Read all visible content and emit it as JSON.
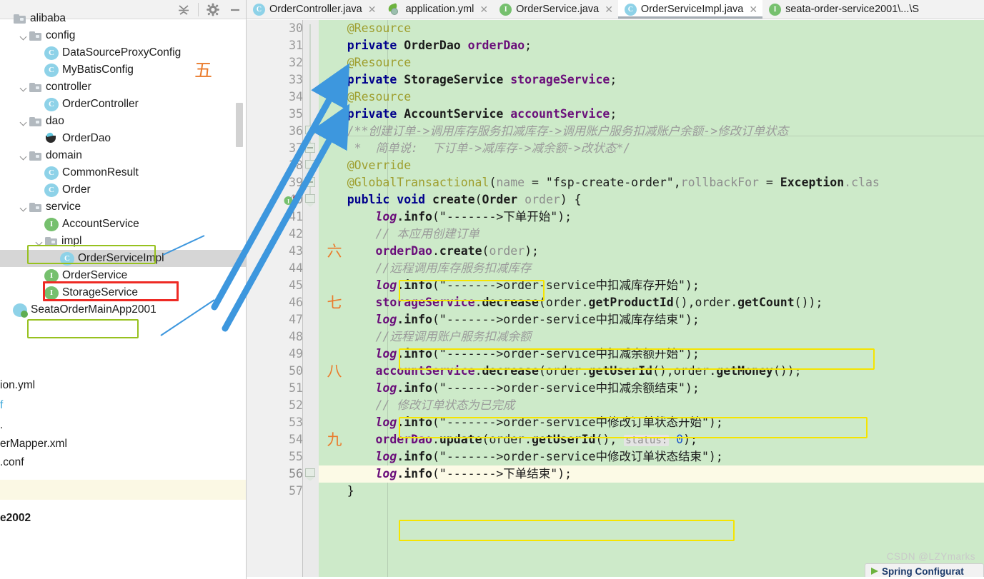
{
  "sidebar": {
    "toolbar": {
      "collapse_all": "collapse-all-icon",
      "settings": "gear-icon",
      "hide": "minimize-icon"
    },
    "items": [
      {
        "label": "alibaba",
        "type": "folder",
        "indent": 0,
        "arrow": false
      },
      {
        "label": "config",
        "type": "folder",
        "indent": 1,
        "arrow": true
      },
      {
        "label": "DataSourceProxyConfig",
        "type": "class",
        "indent": 2,
        "arrow": false
      },
      {
        "label": "MyBatisConfig",
        "type": "class",
        "indent": 2,
        "arrow": false
      },
      {
        "label": "controller",
        "type": "folder",
        "indent": 1,
        "arrow": true
      },
      {
        "label": "OrderController",
        "type": "class",
        "indent": 2,
        "arrow": false
      },
      {
        "label": "dao",
        "type": "folder",
        "indent": 1,
        "arrow": true
      },
      {
        "label": "OrderDao",
        "type": "dao",
        "indent": 2,
        "arrow": false
      },
      {
        "label": "domain",
        "type": "folder",
        "indent": 1,
        "arrow": true
      },
      {
        "label": "CommonResult",
        "type": "class",
        "indent": 2,
        "arrow": false
      },
      {
        "label": "Order",
        "type": "class",
        "indent": 2,
        "arrow": false
      },
      {
        "label": "service",
        "type": "folder",
        "indent": 1,
        "arrow": true
      },
      {
        "label": "AccountService",
        "type": "iface",
        "indent": 2,
        "arrow": false
      },
      {
        "label": "impl",
        "type": "folder",
        "indent": 2,
        "arrow": true
      },
      {
        "label": "OrderServiceImpl",
        "type": "class",
        "indent": 3,
        "arrow": false
      },
      {
        "label": "OrderService",
        "type": "iface",
        "indent": 2,
        "arrow": false
      },
      {
        "label": "StorageService",
        "type": "iface",
        "indent": 2,
        "arrow": false
      },
      {
        "label": "SeataOrderMainApp2001",
        "type": "runapp",
        "indent": 0,
        "arrow": false
      }
    ],
    "clipped_items": [
      {
        "label": "ion.yml"
      },
      {
        "label": "f"
      },
      {
        "label": "."
      },
      {
        "label": "erMapper.xml"
      },
      {
        "label": ".conf"
      },
      {
        "label": "e2002"
      }
    ],
    "annotation_five": "五"
  },
  "tabs": [
    {
      "label": "OrderController.java",
      "icon": "class-icon",
      "active": false,
      "closable": true
    },
    {
      "label": "application.yml",
      "icon": "spring-yml-icon",
      "active": false,
      "closable": true
    },
    {
      "label": "OrderService.java",
      "icon": "interface-icon",
      "active": false,
      "closable": true
    },
    {
      "label": "OrderServiceImpl.java",
      "icon": "class-icon",
      "active": true,
      "closable": true
    },
    {
      "label": "seata-order-service2001\\...\\S",
      "icon": "interface-icon",
      "active": false,
      "closable": false
    }
  ],
  "editor": {
    "first_line": 30,
    "current_line": 56,
    "gutter_marker_line": 40,
    "gutter_marker": "implementing-method-icon",
    "lines": [
      {
        "n": 30,
        "text": "    @Resource"
      },
      {
        "n": 31,
        "text": "    private OrderDao orderDao;"
      },
      {
        "n": 32,
        "text": "    @Resource"
      },
      {
        "n": 33,
        "text": "    private StorageService storageService;"
      },
      {
        "n": 34,
        "text": "    @Resource"
      },
      {
        "n": 35,
        "text": "    private AccountService accountService;"
      },
      {
        "n": 36,
        "text": "    /**创建订单->调用库存服务扣减库存->调用账户服务扣减账户余额->修改订单状态"
      },
      {
        "n": 37,
        "text": "     *  简单说:  下订单->减库存->减余额->改状态*/"
      },
      {
        "n": 38,
        "text": "    @Override"
      },
      {
        "n": 39,
        "text": "    @GlobalTransactional(name = \"fsp-create-order\",rollbackFor = Exception.clas"
      },
      {
        "n": 40,
        "text": "    public void create(Order order) {"
      },
      {
        "n": 41,
        "text": "        log.info(\"------->下单开始\");"
      },
      {
        "n": 42,
        "text": "        // 本应用创建订单"
      },
      {
        "n": 43,
        "text": "        orderDao.create(order);"
      },
      {
        "n": 44,
        "text": "        //远程调用库存服务扣减库存"
      },
      {
        "n": 45,
        "text": "        log.info(\"------->order-service中扣减库存开始\");"
      },
      {
        "n": 46,
        "text": "        storageService.decrease(order.getProductId(),order.getCount());"
      },
      {
        "n": 47,
        "text": "        log.info(\"------->order-service中扣减库存结束\");"
      },
      {
        "n": 48,
        "text": "        //远程调用账户服务扣减余额"
      },
      {
        "n": 49,
        "text": "        log.info(\"------->order-service中扣减余额开始\");"
      },
      {
        "n": 50,
        "text": "        accountService.decrease(order.getUserId(),order.getMoney());"
      },
      {
        "n": 51,
        "text": "        log.info(\"------->order-service中扣减余额结束\");"
      },
      {
        "n": 52,
        "text": "        // 修改订单状态为已完成"
      },
      {
        "n": 53,
        "text": "        log.info(\"------->order-service中修改订单状态开始\");"
      },
      {
        "n": 54,
        "text": "        orderDao.update(order.getUserId(), status: 0);"
      },
      {
        "n": 55,
        "text": "        log.info(\"------->order-service中修改订单状态结束\");"
      },
      {
        "n": 56,
        "text": "        log.info(\"------->下单结束\");"
      },
      {
        "n": 57,
        "text": "    }"
      }
    ],
    "inlay_hint": "status:",
    "annotations": [
      {
        "mark": "六",
        "line": 43
      },
      {
        "mark": "七",
        "line": 46
      },
      {
        "mark": "八",
        "line": 50
      },
      {
        "mark": "九",
        "line": 54
      }
    ]
  },
  "colors": {
    "code_background": "#cdeac9",
    "current_line": "#fcfae6",
    "yellow_box": "#f5e400",
    "green_box": "#97c11f",
    "red_box": "#ee2a24",
    "arrow_blue": "#3d97de",
    "annotation_orange": "#ea7b2c",
    "keyword": "#00008c",
    "string": "#0a7a2a",
    "annotation_token": "#9e9e2e",
    "field": "#6a0e7a"
  },
  "watermark": "CSDN @LZYmarks",
  "popup": {
    "text": "Spring Configurat"
  }
}
